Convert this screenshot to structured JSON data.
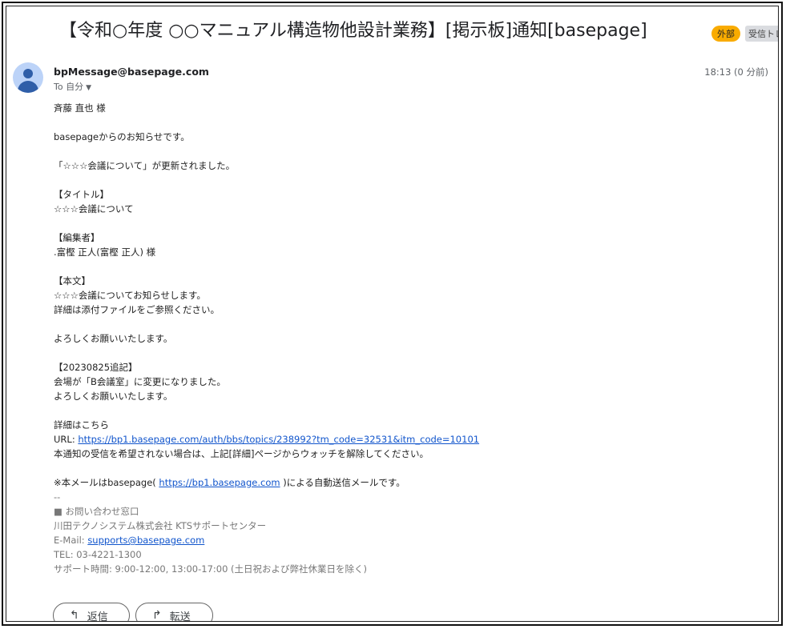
{
  "subject": "【令和○年度 ○○マニュアル構造物他設計業務】[掲示板]通知[basepage]",
  "labels": {
    "external": "外部",
    "inbox": "受信トレ"
  },
  "sender": "bpMessage@basepage.com",
  "time": "18:13 (0 分前)",
  "to": "To 自分",
  "body": {
    "greeting": "斉藤 直也 様",
    "intro": "basepageからのお知らせです。",
    "updated": "「☆☆☆会議について」が更新されました。",
    "title_header": "【タイトル】",
    "title_value": "☆☆☆会議について",
    "editor_header": "【編集者】",
    "editor_value": ".富樫 正人(富樫 正人) 様",
    "text_header": "【本文】",
    "text_line1": "☆☆☆会議についてお知らせします。",
    "text_line2": "詳細は添付ファイルをご参照ください。",
    "regards1": "よろしくお願いいたします。",
    "addendum_header": "【20230825追記】",
    "addendum_line1": "会場が「B会議室」に変更になりました。",
    "addendum_line2": "よろしくお願いいたします。",
    "details_label": "詳細はこちら",
    "url_prefix": "URL: ",
    "url": "https://bp1.basepage.com/auth/bbs/topics/238992?tm_code=32531&itm_code=10101",
    "unwatch_note": "本通知の受信を希望されない場合は、上記[詳細]ページからウォッチを解除してください。",
    "auto_prefix": "※本メールはbasepage( ",
    "auto_link": "https://bp1.basepage.com",
    "auto_suffix": " )による自動送信メールです。",
    "sig_sep": "--",
    "sig_contact": "■ お問い合わせ窓口",
    "sig_company": "川田テクノシステム株式会社 KTSサポートセンター",
    "sig_email_prefix": "E-Mail: ",
    "sig_email": "supports@basepage.com",
    "sig_tel": "TEL: 03-4221-1300",
    "sig_hours": "サポート時間: 9:00-12:00, 13:00-17:00 (土日祝および弊社休業日を除く)"
  },
  "actions": {
    "reply": "返信",
    "forward": "転送"
  }
}
